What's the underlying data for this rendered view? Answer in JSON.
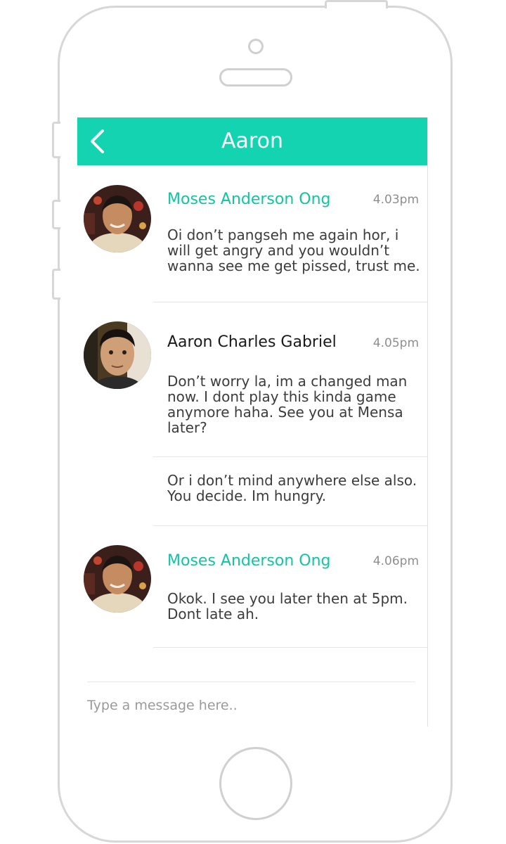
{
  "header": {
    "title": "Aaron",
    "back_icon": "chevron-left-icon",
    "color": "#13d3b0"
  },
  "messages": [
    {
      "sender": "Moses Anderson Ong",
      "time": "4.03pm",
      "text": "Oi don’t pangseh me again hor, i will get angry and you wouldn’t wanna see me get pissed, trust me.",
      "name_color": "#13c4a3"
    },
    {
      "sender": "Aaron Charles Gabriel",
      "time": "4.05pm",
      "text": "Don’t worry la, im a changed man now. I dont play this kinda game anymore haha. See you at Mensa later?",
      "name_color": "#1a1a1a"
    },
    {
      "text": "Or i don’t mind anywhere else also. You decide. Im hungry."
    },
    {
      "sender": "Moses Anderson Ong",
      "time": "4.06pm",
      "text": "Okok. I see you later then at 5pm. Dont late ah.",
      "name_color": "#13c4a3"
    }
  ],
  "composer": {
    "placeholder": "Type a message here.."
  }
}
